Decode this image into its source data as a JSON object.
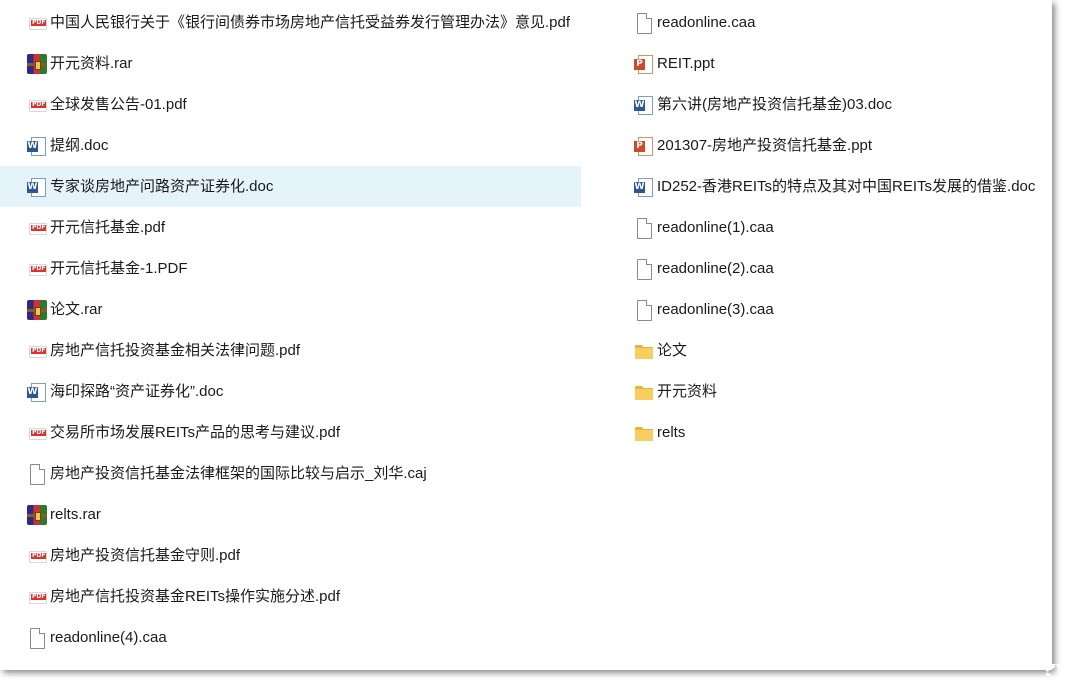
{
  "colors": {
    "selection": "#e5f3fb",
    "pdf_red": "#e0312d",
    "word_blue": "#2b579a",
    "ppt_orange": "#d24726",
    "folder_yellow": "#f8cf5e"
  },
  "files": {
    "left": [
      {
        "name": "中国人民银行关于《银行间债券市场房地产信托受益券发行管理办法》意见.pdf",
        "icon": "pdf-icon"
      },
      {
        "name": "开元资料.rar",
        "icon": "rar-icon"
      },
      {
        "name": "全球发售公告-01.pdf",
        "icon": "pdf-icon"
      },
      {
        "name": "提纲.doc",
        "icon": "doc-icon"
      },
      {
        "name": "专家谈房地产问路资产证券化.doc",
        "icon": "doc-icon",
        "selected": true
      },
      {
        "name": "开元信托基金.pdf",
        "icon": "pdf-icon"
      },
      {
        "name": "开元信托基金-1.PDF",
        "icon": "pdf-icon"
      },
      {
        "name": "论文.rar",
        "icon": "rar-icon"
      },
      {
        "name": "房地产信托投资基金相关法律问题.pdf",
        "icon": "pdf-icon"
      },
      {
        "name": "海印探路“资产证券化”.doc",
        "icon": "doc-icon"
      },
      {
        "name": "交易所市场发展REITs产品的思考与建议.pdf",
        "icon": "pdf-icon"
      },
      {
        "name": "房地产投资信托基金法律框架的国际比较与启示_刘华.caj",
        "icon": "file-icon"
      },
      {
        "name": "relts.rar",
        "icon": "rar-icon"
      },
      {
        "name": "房地产投资信托基金守则.pdf",
        "icon": "pdf-icon"
      },
      {
        "name": "房地产信托投资基金REITs操作实施分述.pdf",
        "icon": "pdf-icon"
      },
      {
        "name": "readonline(4).caa",
        "icon": "file-icon"
      }
    ],
    "right": [
      {
        "name": "readonline.caa",
        "icon": "file-icon"
      },
      {
        "name": "REIT.ppt",
        "icon": "ppt-icon"
      },
      {
        "name": "第六讲(房地产投资信托基金)03.doc",
        "icon": "doc-icon"
      },
      {
        "name": "201307-房地产投资信托基金.ppt",
        "icon": "ppt-icon"
      },
      {
        "name": "ID252-香港REITs的特点及其对中国REITs发展的借鉴.doc",
        "icon": "doc-icon"
      },
      {
        "name": "readonline(1).caa",
        "icon": "file-icon"
      },
      {
        "name": "readonline(2).caa",
        "icon": "file-icon"
      },
      {
        "name": "readonline(3).caa",
        "icon": "file-icon"
      },
      {
        "name": "论文",
        "icon": "folder-icon"
      },
      {
        "name": "开元资料",
        "icon": "folder-icon"
      },
      {
        "name": "relts",
        "icon": "folder-icon"
      }
    ]
  }
}
